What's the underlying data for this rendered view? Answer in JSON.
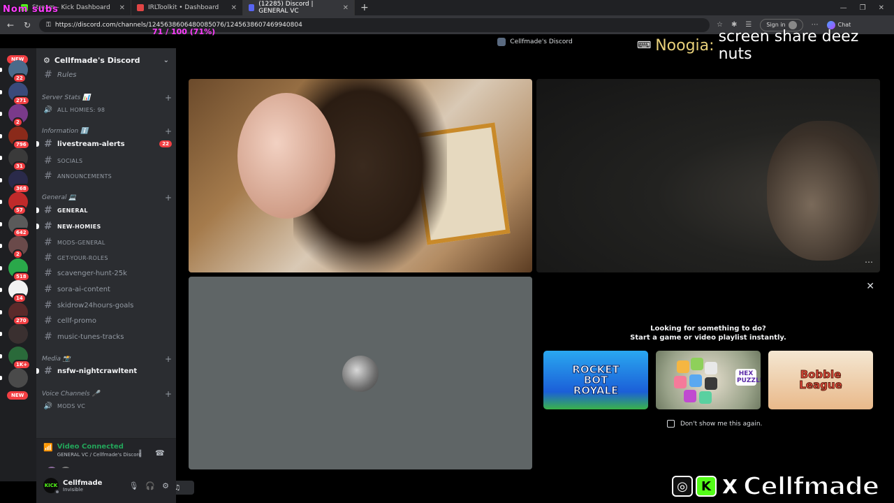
{
  "browser": {
    "tabs": [
      {
        "label": "Stream - Kick Dashboard",
        "color": "#53fc18"
      },
      {
        "label": "IRLToolkit • Dashboard",
        "color": "#e04545"
      },
      {
        "label": "(12285) Discord | GENERAL VC",
        "color": "#5865f2",
        "active": true
      }
    ],
    "new_tab": "+",
    "url": "https://discord.com/channels/1245638606480085076/1245638607469940804",
    "sign_in": "Sign in",
    "chat": "Chat"
  },
  "overlays": {
    "goal": "71 / 100 (71%)",
    "follow_sub": "Nom subs",
    "chat_user": "Noogia:",
    "chat_msg": "screen share deez nuts",
    "brand_x": "X",
    "brand_k": "K",
    "brand_name": "Cellfmade"
  },
  "guilds": {
    "top_badge": "NEW",
    "bottom_badge": "NEW",
    "items": [
      {
        "badge": "22",
        "color": "#4b6a8a"
      },
      {
        "badge": "271",
        "color": "#3a4a7a"
      },
      {
        "badge": "2",
        "color": "#7a3a8a"
      },
      {
        "badge": "796",
        "color": "#8a2a1a"
      },
      {
        "badge": "31",
        "color": "#3a3a3a"
      },
      {
        "badge": "368",
        "color": "#2a2a4a"
      },
      {
        "badge": "57",
        "color": "#c02a2a"
      },
      {
        "badge": "642",
        "color": "#5a5a5a"
      },
      {
        "badge": "2",
        "color": "#6a4a4a"
      },
      {
        "badge": "518",
        "color": "#2aa84a"
      },
      {
        "badge": "14",
        "color": "#f2f2f2"
      },
      {
        "badge": "270",
        "color": "#5a2a2a"
      },
      {
        "badge": "",
        "color": "#3a3030"
      },
      {
        "badge": "1K+",
        "color": "#2a6a3a"
      },
      {
        "badge": "",
        "color": "#4a4a4a"
      }
    ]
  },
  "server": {
    "name": "Cellfmade's Discord",
    "channels": [
      {
        "type": "text",
        "label": "Rules",
        "style": "italic"
      },
      {
        "type": "cat",
        "label": "Server Stats 📊"
      },
      {
        "type": "voice",
        "label": "ALL HOMIES: 98",
        "style": "small"
      },
      {
        "type": "cat",
        "label": "Information ℹ️"
      },
      {
        "type": "text",
        "label": "livestream-alerts",
        "style": "bold",
        "count": "22"
      },
      {
        "type": "text",
        "label": "SOCIALS",
        "style": "small"
      },
      {
        "type": "text",
        "label": "ANNOUNCEMENTS",
        "style": "small"
      },
      {
        "type": "cat",
        "label": "General 💻"
      },
      {
        "type": "text",
        "label": "GENERAL",
        "style": "small-bold"
      },
      {
        "type": "text",
        "label": "NEW-HOMIES",
        "style": "small-bold"
      },
      {
        "type": "text",
        "label": "MODS-GENERAL",
        "style": "small"
      },
      {
        "type": "text",
        "label": "GET-YOUR-ROLES",
        "style": "small"
      },
      {
        "type": "text",
        "label": "scavenger-hunt-25k"
      },
      {
        "type": "text",
        "label": "sora-ai-content"
      },
      {
        "type": "text",
        "label": "skidrow24hours-goals"
      },
      {
        "type": "text",
        "label": "cellf-promo"
      },
      {
        "type": "text",
        "label": "music-tunes-tracks"
      },
      {
        "type": "cat",
        "label": "Media 📸"
      },
      {
        "type": "text",
        "label": "nsfw-nightcrawltent",
        "style": "bold"
      },
      {
        "type": "cat",
        "label": "Voice Channels 🎤"
      },
      {
        "type": "voice",
        "label": "MODS VC",
        "style": "small"
      }
    ]
  },
  "voice": {
    "status": "Video Connected",
    "location": "GENERAL VC / Cellfmade's Discord"
  },
  "user": {
    "name": "Cellfmade",
    "status": "Invisible",
    "avatar_text": "KICK"
  },
  "stage": {
    "title": "Cellfmade's Discord",
    "activity_line1": "Looking for something to do?",
    "activity_line2": "Start a game or video playlist instantly.",
    "games": [
      "ROCKET BOT ROYALE",
      "HEX PUZZLE",
      "Bobble League"
    ],
    "dont_show": "Don't show me this again."
  }
}
